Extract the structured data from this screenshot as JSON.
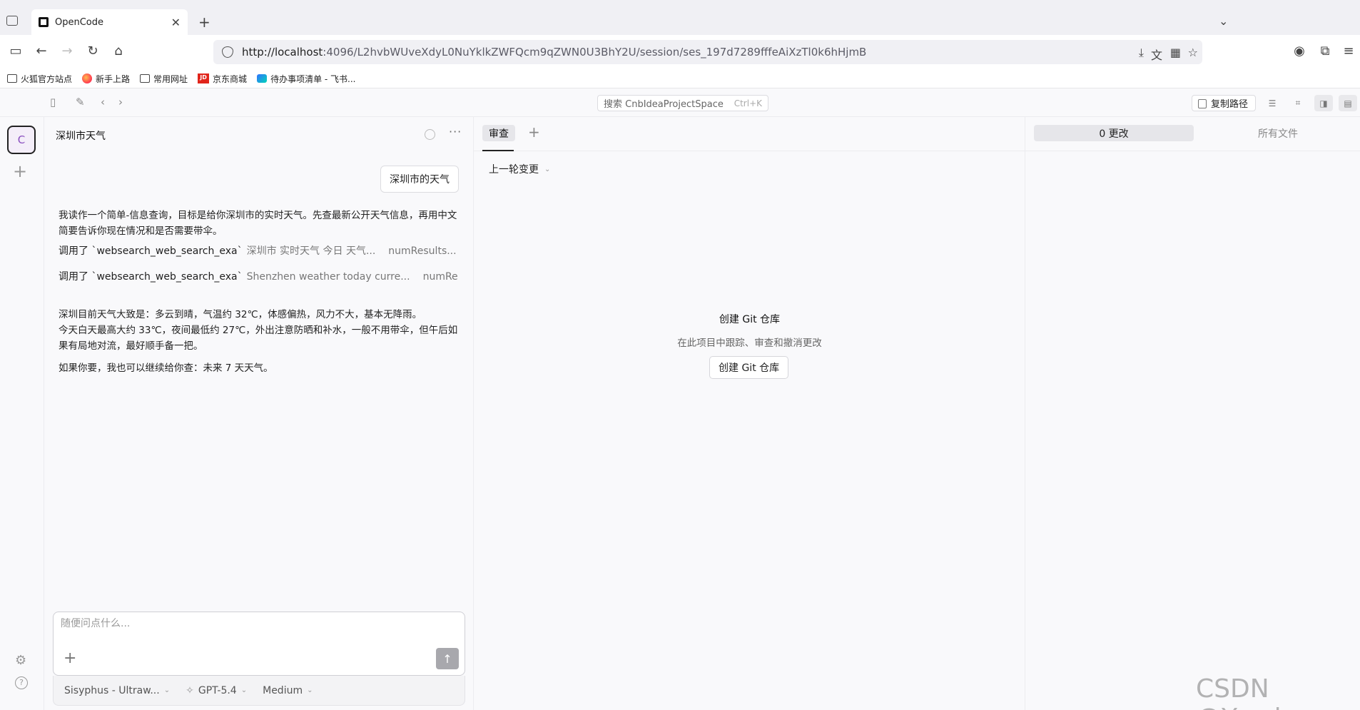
{
  "browser": {
    "tab_title": "OpenCode",
    "url_host": "http://localhost",
    "url_rest": ":4096/L2hvbWUveXdyL0NuYklkZWFQcm9qZWN0U3BhY2U/session/ses_197d7289fffeAiXzTl0k6hHjmB",
    "bookmarks": [
      "火狐官方站点",
      "新手上路",
      "常用网址",
      "京东商城",
      "待办事项清单 - 飞书..."
    ]
  },
  "app": {
    "search_placeholder": "搜索 CnbIdeaProjectSpace",
    "search_shortcut": "Ctrl+K",
    "copy_path_label": "复制路径",
    "project_initial": "C"
  },
  "chat": {
    "title": "深圳市天气",
    "user_message": "深圳市的天气",
    "assistant_intro": "我读作一个简单-信息查询，目标是给你深圳市的实时天气。先查最新公开天气信息，再用中文简要告诉你现在情况和是否需要带伞。",
    "tool_calls": [
      {
        "label": "调用了 `websearch_web_search_exa`",
        "args": "深圳市 实时天气 今日 天气...",
        "extra": "numResults..."
      },
      {
        "label": "调用了 `websearch_web_search_exa`",
        "args": "Shenzhen weather today curre...",
        "extra": "numRe..."
      }
    ],
    "answer_line1": "深圳目前天气大致是：多云到晴，气温约 32℃，体感偏热，风力不大，基本无降雨。",
    "answer_line2": "今天白天最高大约 33℃，夜间最低约 27℃，外出注意防晒和补水，一般不用带伞，但午后如果有局地对流，最好顺手备一把。",
    "answer_followup": "如果你要，我也可以继续给你查：未来 7 天天气。",
    "composer_placeholder": "随便问点什么...",
    "agent": "Sisyphus - Ultraw...",
    "model": "GPT-5.4",
    "effort": "Medium"
  },
  "review": {
    "tab_label": "审查",
    "last_change_label": "上一轮变更",
    "empty_title": "创建 Git 仓库",
    "empty_subtitle": "在此项目中跟踪、审查和撤消更改",
    "create_button": "创建 Git 仓库"
  },
  "files": {
    "changes_tab": "0 更改",
    "all_files_tab": "所有文件"
  },
  "watermark": "CSDN @Yweir"
}
